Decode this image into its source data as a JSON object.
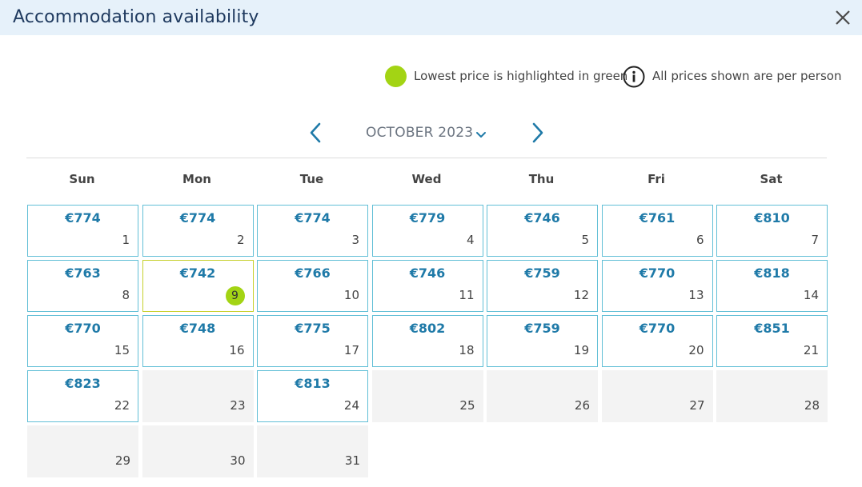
{
  "header": {
    "title": "Accommodation availability"
  },
  "legend": {
    "lowest_text": "Lowest price is highlighted in green",
    "per_person_text": "All prices shown are per person",
    "highlight_color": "#a3d414"
  },
  "nav": {
    "month_label": "OCTOBER 2023"
  },
  "weekdays": [
    "Sun",
    "Mon",
    "Tue",
    "Wed",
    "Thu",
    "Fri",
    "Sat"
  ],
  "days": [
    {
      "day": "1",
      "price": "€774",
      "available": true
    },
    {
      "day": "2",
      "price": "€774",
      "available": true
    },
    {
      "day": "3",
      "price": "€774",
      "available": true
    },
    {
      "day": "4",
      "price": "€779",
      "available": true
    },
    {
      "day": "5",
      "price": "€746",
      "available": true
    },
    {
      "day": "6",
      "price": "€761",
      "available": true
    },
    {
      "day": "7",
      "price": "€810",
      "available": true
    },
    {
      "day": "8",
      "price": "€763",
      "available": true
    },
    {
      "day": "9",
      "price": "€742",
      "available": true,
      "lowest": true
    },
    {
      "day": "10",
      "price": "€766",
      "available": true
    },
    {
      "day": "11",
      "price": "€746",
      "available": true
    },
    {
      "day": "12",
      "price": "€759",
      "available": true
    },
    {
      "day": "13",
      "price": "€770",
      "available": true
    },
    {
      "day": "14",
      "price": "€818",
      "available": true
    },
    {
      "day": "15",
      "price": "€770",
      "available": true
    },
    {
      "day": "16",
      "price": "€748",
      "available": true
    },
    {
      "day": "17",
      "price": "€775",
      "available": true
    },
    {
      "day": "18",
      "price": "€802",
      "available": true
    },
    {
      "day": "19",
      "price": "€759",
      "available": true
    },
    {
      "day": "20",
      "price": "€770",
      "available": true
    },
    {
      "day": "21",
      "price": "€851",
      "available": true
    },
    {
      "day": "22",
      "price": "€823",
      "available": true
    },
    {
      "day": "23",
      "price": "",
      "available": false
    },
    {
      "day": "24",
      "price": "€813",
      "available": true
    },
    {
      "day": "25",
      "price": "",
      "available": false
    },
    {
      "day": "26",
      "price": "",
      "available": false
    },
    {
      "day": "27",
      "price": "",
      "available": false
    },
    {
      "day": "28",
      "price": "",
      "available": false
    },
    {
      "day": "29",
      "price": "",
      "available": false
    },
    {
      "day": "30",
      "price": "",
      "available": false
    },
    {
      "day": "31",
      "price": "",
      "available": false
    }
  ]
}
